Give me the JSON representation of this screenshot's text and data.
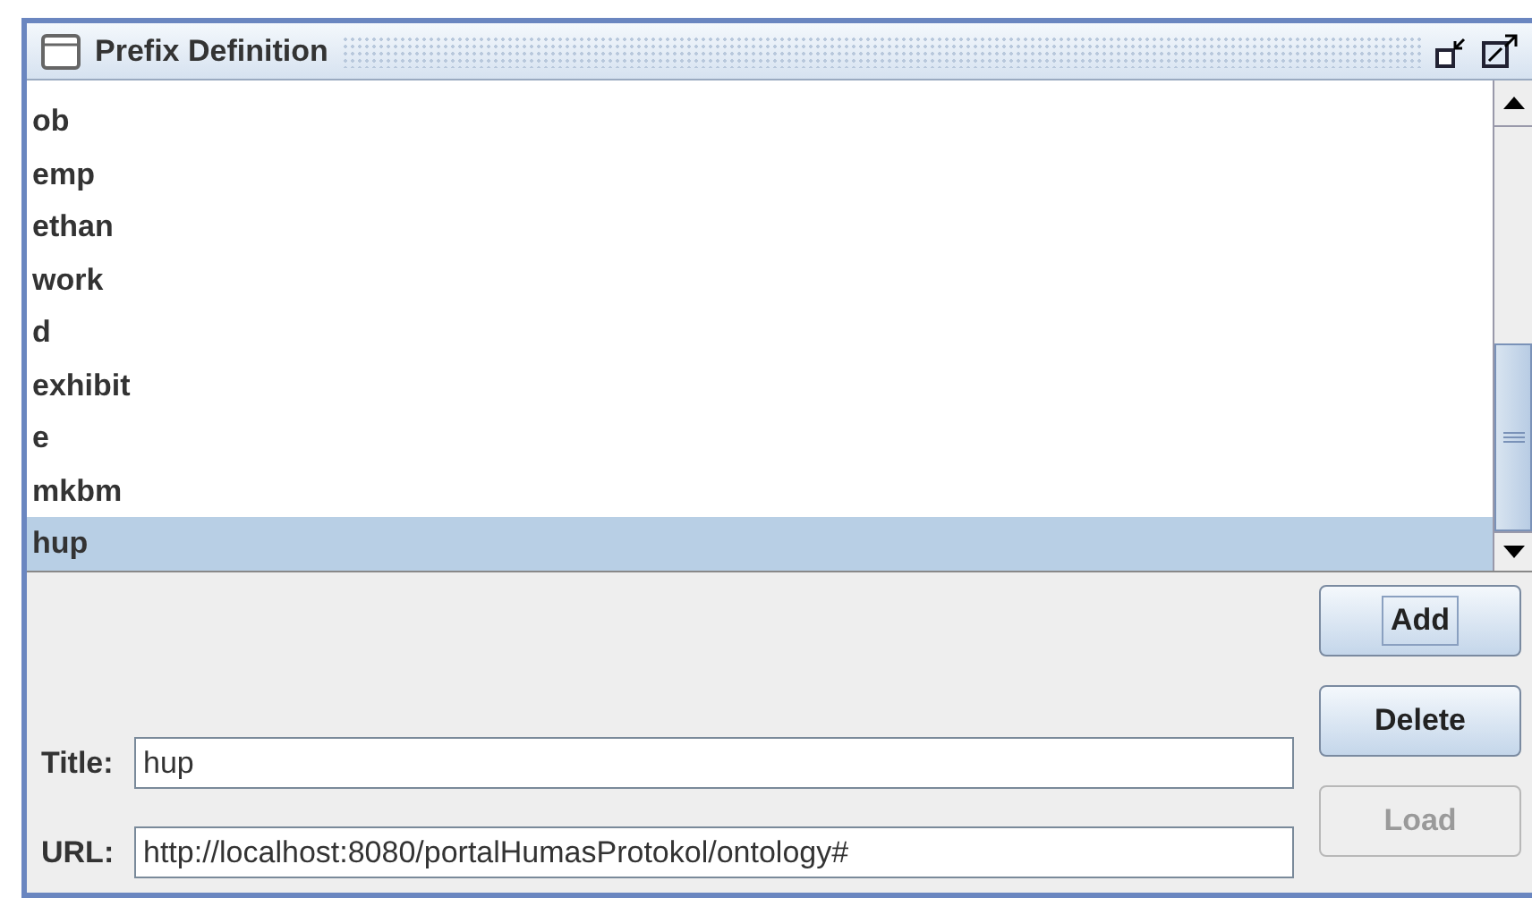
{
  "window": {
    "title": "Prefix Definition"
  },
  "prefixes": [
    {
      "label": "ob",
      "selected": false
    },
    {
      "label": "emp",
      "selected": false
    },
    {
      "label": "ethan",
      "selected": false
    },
    {
      "label": "work",
      "selected": false
    },
    {
      "label": "d",
      "selected": false
    },
    {
      "label": "exhibit",
      "selected": false
    },
    {
      "label": "e",
      "selected": false
    },
    {
      "label": "mkbm",
      "selected": false
    },
    {
      "label": "hup",
      "selected": true
    }
  ],
  "buttons": [
    {
      "label": "Add",
      "disabled": false,
      "focused": true
    },
    {
      "label": "Delete",
      "disabled": false,
      "focused": false
    },
    {
      "label": "Load",
      "disabled": true,
      "focused": false
    }
  ],
  "fields": [
    {
      "label": "Title:",
      "value": "hup"
    },
    {
      "label": "URL:",
      "value": "http://localhost:8080/portalHumasProtokol/ontology#"
    }
  ]
}
